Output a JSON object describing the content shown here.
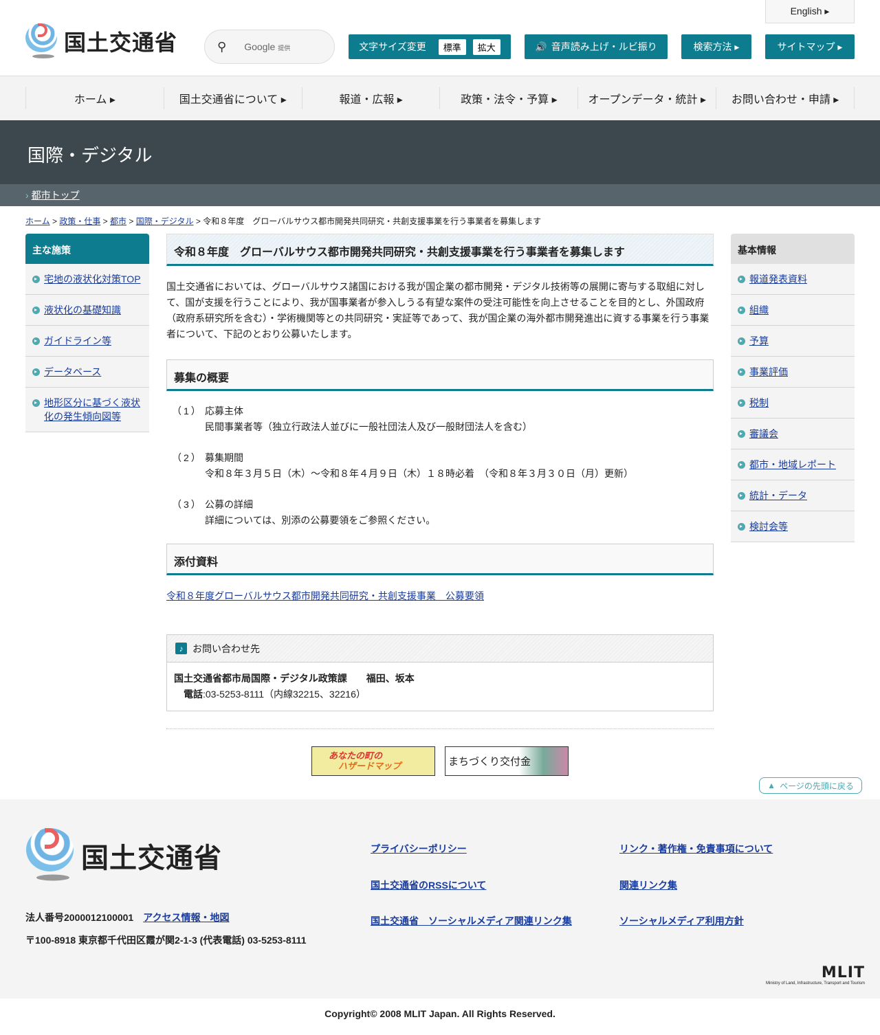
{
  "header": {
    "logo_text": "国土交通省",
    "search_label": "Google",
    "search_sub": "提供",
    "english": "English ▸",
    "font_size_label": "文字サイズ変更",
    "font_std": "標準",
    "font_large": "拡大",
    "speech": "音声読み上げ・ルビ振り",
    "search_method": "検索方法 ▸",
    "sitemap": "サイトマップ ▸"
  },
  "nav": [
    "ホーム ▸",
    "国土交通省について ▸",
    "報道・広報 ▸",
    "政策・法令・予算 ▸",
    "オープンデータ・統計 ▸",
    "お問い合わせ・申請 ▸"
  ],
  "band_title": "国際・デジタル",
  "sub_link": "都市トップ",
  "breadcrumb": {
    "links": [
      "ホーム",
      "政策・仕事",
      "都市",
      "国際・デジタル"
    ],
    "sep": " > ",
    "current": "令和８年度　グローバルサウス都市開発共同研究・共創支援事業を行う事業者を募集します"
  },
  "left": {
    "title": "主な施策",
    "items": [
      "宅地の液状化対策TOP",
      "液状化の基礎知識",
      "ガイドライン等",
      "データベース",
      "地形区分に基づく液状化の発生傾向図等"
    ]
  },
  "right": {
    "title": "基本情報",
    "items": [
      "報道発表資料",
      "組織",
      "予算",
      "事業評価",
      "税制",
      "審議会",
      "都市・地域レポート",
      "統計・データ",
      "検討会等"
    ]
  },
  "main": {
    "title": "令和８年度　グローバルサウス都市開発共同研究・共創支援事業を行う事業者を募集します",
    "intro": "国土交通省においては、グローバルサウス諸国における我が国企業の都市開発・デジタル技術等の展開に寄与する取組に対して、国が支援を行うことにより、我が国事業者が参入しうる有望な案件の受注可能性を向上させることを目的とし、外国政府（政府系研究所を含む）・学術機関等との共同研究・実証等であって、我が国企業の海外都市開発進出に資する事業を行う事業者について、下記のとおり公募いたします。",
    "section1": "募集の概要",
    "items": [
      {
        "num": "（1）",
        "head": "応募主体",
        "body": "民間事業者等（独立行政法人並びに一般社団法人及び一般財団法人を含む）"
      },
      {
        "num": "（2）",
        "head": "募集期間",
        "body": "令和８年３月５日（木）～令和８年４月９日（木）１８時必着　（令和８年３月３０日（月）更新）"
      },
      {
        "num": "（3）",
        "head": "公募の詳細",
        "body": "詳細については、別添の公募要領をご参照ください。"
      }
    ],
    "section2": "添付資料",
    "attachment": "令和８年度グローバルサウス都市開発共同研究・共創支援事業　公募要領",
    "contact": {
      "title": "お問い合わせ先",
      "org": "国土交通省都市局国際・デジタル政策課　　福田、坂本",
      "tel_label": "電話",
      "tel": ":03-5253-8111（内線32215、32216）"
    },
    "banner1_l1": "あなたの町の",
    "banner1_l2": "ハザードマップ",
    "banner2": "まちづくり交付金"
  },
  "to_top": "ページの先頭に戻る",
  "footer": {
    "logo_text": "国土交通省",
    "corp_no": "法人番号2000012100001",
    "access": "アクセス情報・地図",
    "address": "〒100-8918 東京都千代田区霞が関2-1-3 (代表電話) 03-5253-8111",
    "links": [
      "プライバシーポリシー",
      "リンク・著作権・免責事項について",
      "国土交通省のRSSについて",
      "関連リンク集",
      "国土交通省　ソーシャルメディア関連リンク集",
      "ソーシャルメディア利用方針"
    ],
    "mlit": "MLIT",
    "mlit_sub": "Ministry of Land, Infrastructure, Transport and Tourism",
    "copyright": "Copyright© 2008 MLIT Japan. All Rights Reserved."
  },
  "colors": {
    "accent": "#0e7c8f",
    "band": "#3c474e",
    "link": "#1a3c9c"
  }
}
